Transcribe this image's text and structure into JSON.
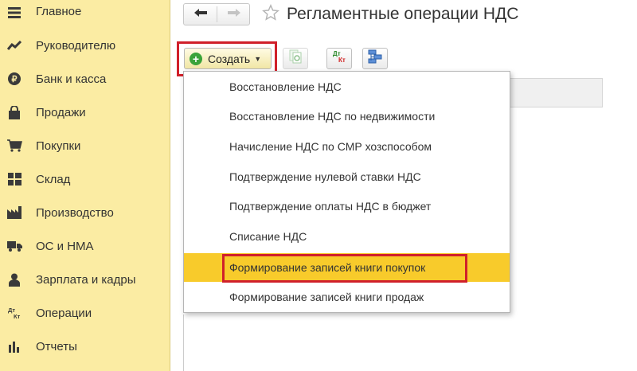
{
  "sidebar": {
    "items": [
      {
        "label": "Главное",
        "icon": "menu-lines-icon"
      },
      {
        "label": "Руководителю",
        "icon": "trend-chart-icon"
      },
      {
        "label": "Банк и касса",
        "icon": "coin-icon"
      },
      {
        "label": "Продажи",
        "icon": "shopping-bag-icon"
      },
      {
        "label": "Покупки",
        "icon": "shopping-cart-icon"
      },
      {
        "label": "Склад",
        "icon": "warehouse-grid-icon"
      },
      {
        "label": "Производство",
        "icon": "factory-icon"
      },
      {
        "label": "ОС и НМА",
        "icon": "truck-icon"
      },
      {
        "label": "Зарплата и кадры",
        "icon": "person-icon"
      },
      {
        "label": "Операции",
        "icon": "dt-kt-icon"
      },
      {
        "label": "Отчеты",
        "icon": "bar-chart-icon"
      }
    ]
  },
  "header": {
    "title": "Регламентные операции НДС",
    "back_icon": "arrow-left-icon",
    "forward_icon": "arrow-right-icon",
    "favorite_icon": "star-outline-icon"
  },
  "toolbar": {
    "create_label": "Создать",
    "create_icon": "plus-circle-icon",
    "dtkt": {
      "top": "Дт",
      "bottom": "Кт"
    }
  },
  "dropdown": {
    "items": [
      "Восстановление НДС",
      "Восстановление НДС по недвижимости",
      "Начисление НДС по СМР хозспособом",
      "Подтверждение нулевой ставки НДС",
      "Подтверждение оплаты НДС в бюджет",
      "Списание НДС",
      "Формирование записей книги покупок",
      "Формирование записей книги продаж"
    ],
    "selected_index": 6
  },
  "colors": {
    "sidebar_bg": "#fbeca3",
    "selected_bg": "#f8cb2b",
    "highlight_border": "#d0202a",
    "create_icon": "#3aa33a"
  }
}
